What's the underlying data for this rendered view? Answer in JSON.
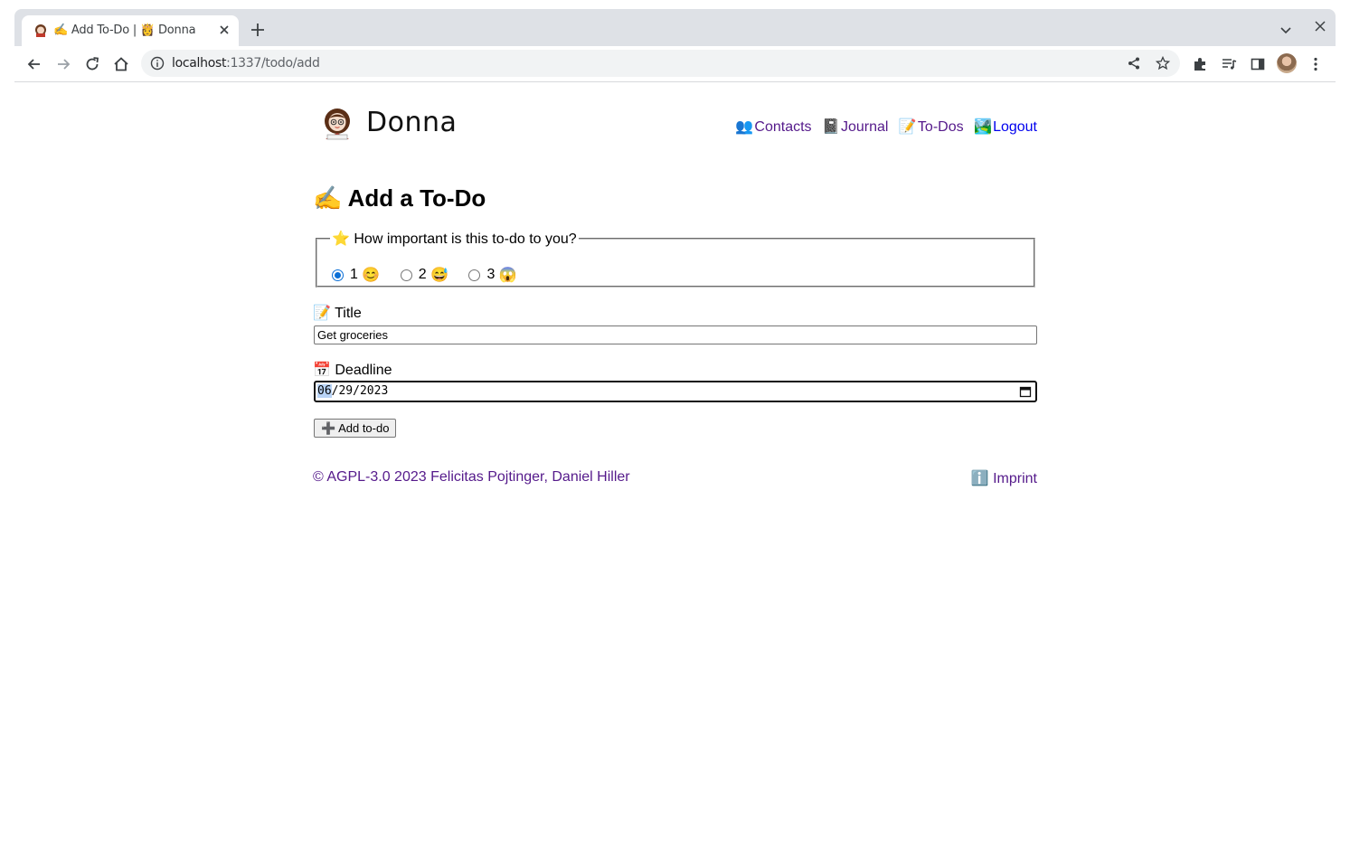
{
  "browser": {
    "tab_title": "✍️ Add To-Do | 👸 Donna",
    "url_host": "localhost",
    "url_path": ":1337/todo/add"
  },
  "site": {
    "brand": "Donna",
    "nav": [
      {
        "emoji": "👥",
        "label": "Contacts"
      },
      {
        "emoji": "📓",
        "label": "Journal"
      },
      {
        "emoji": "📝",
        "label": "To-Dos"
      },
      {
        "emoji": "🏞️",
        "label": "Logout"
      }
    ]
  },
  "form": {
    "heading": "✍️ Add a To-Do",
    "importance": {
      "legend": "⭐ How important is this to-do to you?",
      "options": [
        {
          "value": "1",
          "emoji": "😊",
          "checked": true
        },
        {
          "value": "2",
          "emoji": "😅",
          "checked": false
        },
        {
          "value": "3",
          "emoji": "😱",
          "checked": false
        }
      ]
    },
    "title_label": "📝 Title",
    "title_value": "Get groceries",
    "deadline_label": "📅 Deadline",
    "deadline_month": "06",
    "deadline_rest": "/29/2023",
    "submit_label": "➕ Add to-do"
  },
  "footer": {
    "copyright": "© AGPL-3.0 2023 Felicitas Pojtinger, Daniel Hiller",
    "imprint": "ℹ️ Imprint"
  }
}
